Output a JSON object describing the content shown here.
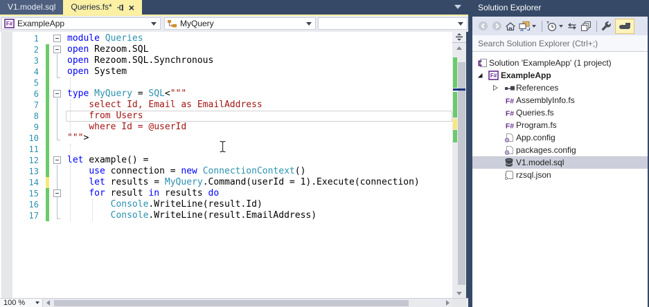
{
  "tabs": {
    "items": [
      {
        "label": "V1.model.sql",
        "active": false
      },
      {
        "label": "Queries.fs*",
        "active": true,
        "controls": [
          "pin-icon",
          "close-icon"
        ]
      }
    ]
  },
  "navbar": {
    "project_selector": "ExampleApp",
    "scope_selector": "MyQuery",
    "secondary_selector": ""
  },
  "editor": {
    "zoom_level": "100 %",
    "current_line": 8,
    "lines": [
      {
        "n": 1,
        "fold": true,
        "change": null,
        "tokens": [
          [
            "kw",
            "module"
          ],
          [
            "pl",
            " "
          ],
          [
            "ty",
            "Queries"
          ]
        ]
      },
      {
        "n": 2,
        "fold": true,
        "change": "green",
        "tokens": [
          [
            "kw",
            "open"
          ],
          [
            "pl",
            " Rezoom.SQL"
          ]
        ]
      },
      {
        "n": 3,
        "fold": false,
        "change": "green",
        "tokens": [
          [
            "kw",
            "open"
          ],
          [
            "pl",
            " Rezoom.SQL.Synchronous"
          ]
        ]
      },
      {
        "n": 4,
        "fold": false,
        "change": "green",
        "tokens": [
          [
            "kw",
            "open"
          ],
          [
            "pl",
            " System"
          ]
        ]
      },
      {
        "n": 5,
        "fold": false,
        "change": "green",
        "tokens": []
      },
      {
        "n": 6,
        "fold": true,
        "change": "green",
        "tokens": [
          [
            "kw",
            "type"
          ],
          [
            "pl",
            " "
          ],
          [
            "ty",
            "MyQuery"
          ],
          [
            "pl",
            " = "
          ],
          [
            "ty",
            "SQL"
          ],
          [
            "pl",
            "<"
          ],
          [
            "str",
            "\"\"\""
          ]
        ]
      },
      {
        "n": 7,
        "fold": false,
        "change": "green",
        "tokens": [
          [
            "str",
            "    select Id, Email as EmailAddress"
          ]
        ]
      },
      {
        "n": 8,
        "fold": false,
        "change": "green",
        "tokens": [
          [
            "str",
            "    from Users"
          ]
        ],
        "current": true
      },
      {
        "n": 9,
        "fold": false,
        "change": "green",
        "tokens": [
          [
            "str",
            "    where Id = @userId"
          ]
        ]
      },
      {
        "n": 10,
        "fold": false,
        "change": "green",
        "tokens": [
          [
            "str",
            "\"\"\""
          ],
          [
            "pl",
            ">"
          ]
        ]
      },
      {
        "n": 11,
        "fold": false,
        "change": "green",
        "tokens": []
      },
      {
        "n": 12,
        "fold": true,
        "change": "green",
        "tokens": [
          [
            "kw",
            "let"
          ],
          [
            "pl",
            " example() ="
          ]
        ]
      },
      {
        "n": 13,
        "fold": false,
        "change": "green",
        "tokens": [
          [
            "pl",
            "    "
          ],
          [
            "kw",
            "use"
          ],
          [
            "pl",
            " connection = "
          ],
          [
            "kw",
            "new"
          ],
          [
            "pl",
            " "
          ],
          [
            "ty",
            "ConnectionContext"
          ],
          [
            "pl",
            "()"
          ]
        ]
      },
      {
        "n": 14,
        "fold": false,
        "change": "yellow",
        "tokens": [
          [
            "pl",
            "    "
          ],
          [
            "kw",
            "let"
          ],
          [
            "pl",
            " results = "
          ],
          [
            "ty",
            "MyQuery"
          ],
          [
            "pl",
            ".Command(userId = 1).Execute(connection)"
          ]
        ]
      },
      {
        "n": 15,
        "fold": true,
        "change": "green",
        "tokens": [
          [
            "pl",
            "    "
          ],
          [
            "kw",
            "for"
          ],
          [
            "pl",
            " result "
          ],
          [
            "kw",
            "in"
          ],
          [
            "pl",
            " results "
          ],
          [
            "kw",
            "do"
          ]
        ]
      },
      {
        "n": 16,
        "fold": false,
        "change": "green",
        "tokens": [
          [
            "pl",
            "        "
          ],
          [
            "ty",
            "Console"
          ],
          [
            "pl",
            ".WriteLine(result.Id)"
          ]
        ]
      },
      {
        "n": 17,
        "fold": false,
        "change": "green",
        "tokens": [
          [
            "pl",
            "        "
          ],
          [
            "ty",
            "Console"
          ],
          [
            "pl",
            ".WriteLine(result.EmailAddress)"
          ]
        ]
      }
    ]
  },
  "solution_explorer": {
    "title": "Solution Explorer",
    "search_placeholder": "Search Solution Explorer (Ctrl+;)",
    "toolbar": [
      {
        "name": "back-button",
        "disabled": true
      },
      {
        "name": "forward-button",
        "disabled": true
      },
      {
        "name": "home-button"
      },
      {
        "name": "switch-views-button",
        "dropdown": true
      },
      {
        "sep": true
      },
      {
        "name": "pending-changes-filter-button",
        "dropdown": true
      },
      {
        "name": "sync-with-active-document-button"
      },
      {
        "name": "collapse-all-button"
      },
      {
        "sep": true
      },
      {
        "name": "properties-button"
      },
      {
        "name": "preview-selected-items-toggle",
        "active": true
      }
    ],
    "tree": [
      {
        "label": "Solution 'ExampleApp' (1 project)",
        "icon": "solution-icon",
        "level": 0
      },
      {
        "label": "ExampleApp",
        "icon": "fsharp-project-icon",
        "level": 1,
        "arrow": "expanded",
        "bold": true
      },
      {
        "label": "References",
        "icon": "references-icon",
        "level": 2,
        "arrow": "collapsed"
      },
      {
        "label": "AssemblyInfo.fs",
        "icon": "fsharp-file-icon",
        "level": 2
      },
      {
        "label": "Queries.fs",
        "icon": "fsharp-file-icon",
        "level": 2
      },
      {
        "label": "Program.fs",
        "icon": "fsharp-file-icon",
        "level": 2
      },
      {
        "label": "App.config",
        "icon": "config-file-icon",
        "level": 2
      },
      {
        "label": "packages.config",
        "icon": "config-file-icon",
        "level": 2
      },
      {
        "label": "V1.model.sql",
        "icon": "database-file-icon",
        "level": 2,
        "selected": true
      },
      {
        "label": "rzsql.json",
        "icon": "json-file-icon",
        "level": 2
      }
    ]
  },
  "colors": {
    "keyword": "#0000FF",
    "type": "#2B91AF",
    "string": "#A31515",
    "line_number": "#2B91AF",
    "active_tab_bg": "#FBF0A3",
    "change_saved": "#6ACB6A",
    "change_unsaved": "#F7E87A",
    "inactive_selection": "#CCCEDB",
    "frame": "#364A67"
  }
}
